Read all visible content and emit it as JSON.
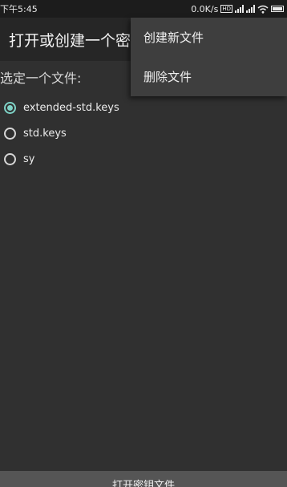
{
  "status_bar": {
    "time": "下午5:45",
    "net_speed": "0.0K/s",
    "hd_label": "HD",
    "icons": [
      "hd-icon",
      "signal-icon",
      "signal-icon",
      "wifi-icon",
      "battery-icon"
    ]
  },
  "app_bar": {
    "title": "打开或创建一个密钥文件"
  },
  "overflow_menu": {
    "items": [
      {
        "label": "创建新文件"
      },
      {
        "label": "删除文件"
      }
    ]
  },
  "file_picker": {
    "prompt": "选定一个文件:",
    "options": [
      {
        "label": "extended-std.keys",
        "checked": true
      },
      {
        "label": "std.keys",
        "checked": false
      },
      {
        "label": "sy",
        "checked": false
      }
    ]
  },
  "bottom_button": {
    "label": "打开密钥文件"
  },
  "colors": {
    "accent": "#7fd3c7",
    "background": "#303030",
    "app_bar": "#262626",
    "menu": "#3e3e3e"
  }
}
